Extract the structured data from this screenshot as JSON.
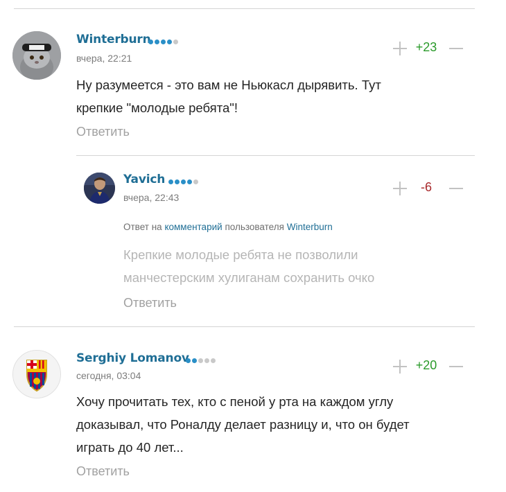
{
  "comments": [
    {
      "username": "Winterburn",
      "avatar": "cat-avatar-icon",
      "rank_dots": [
        "#2a8fc7",
        "#2a8fc7",
        "#2a8fc7",
        "#2a8fc7",
        "#c9c9c9"
      ],
      "timestamp": "вчера, 22:21",
      "score": "+23",
      "score_color": "#2a9a2a",
      "body_lines": [
        "Ну разумеется - это вам не Ньюкасл дырявить. Тут",
        "крепкие \"молодые ребята\"!"
      ],
      "reply_label": "Ответить"
    },
    {
      "username": "Yavich",
      "avatar": "player-avatar-icon",
      "rank_dots": [
        "#2a8fc7",
        "#2a8fc7",
        "#2a8fc7",
        "#2a8fc7",
        "#c9c9c9"
      ],
      "timestamp": "вчера, 22:43",
      "score": "-6",
      "score_color": "#a8282b",
      "reply_to": {
        "prefix": "Ответ на",
        "link": "комментарий",
        "middle": "пользователя",
        "user": "Winterburn"
      },
      "body_lines": [
        "Крепкие молодые ребята не позволили",
        "манчестерским хулиганам сохранить очко"
      ],
      "reply_label": "Ответить"
    },
    {
      "username": "Serghiy Lomanov",
      "avatar": "fcb-crest-avatar-icon",
      "rank_dots": [
        "#2a8fc7",
        "#2a8fc7",
        "#c9c9c9",
        "#c9c9c9",
        "#c9c9c9"
      ],
      "timestamp": "сегодня, 03:04",
      "score": "+20",
      "score_color": "#2a9a2a",
      "body_lines": [
        "Хочу прочитать тех, кто с пеной у рта на каждом углу",
        "доказывал, что Роналду делает разницу и, что он будет",
        "играть до 40 лет..."
      ],
      "reply_label": "Ответить"
    }
  ],
  "vote_icons": {
    "up": "plus-icon",
    "down": "minus-icon"
  }
}
